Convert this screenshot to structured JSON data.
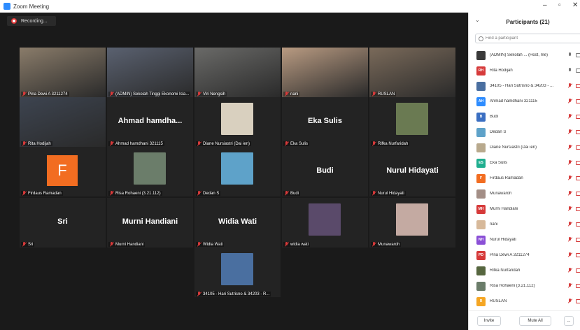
{
  "window": {
    "title": "Zoom Meeting",
    "controls": [
      "–",
      "▫",
      "✕"
    ]
  },
  "recording": {
    "label": "Recording..."
  },
  "tiles": [
    {
      "name": "Pina Dewi A 3211274",
      "big": "",
      "kind": "video",
      "color": "#8a7c6a"
    },
    {
      "name": "(ADMIN) Sekolah Tinggi Ekonomi Isla...",
      "big": "",
      "kind": "video",
      "color": "#5a6170"
    },
    {
      "name": "Viri Nengsih",
      "big": "",
      "kind": "video",
      "color": "#6a6a68"
    },
    {
      "name": "nani",
      "big": "",
      "kind": "video",
      "color": "#b99b82"
    },
    {
      "name": "RUSLAN",
      "big": "",
      "kind": "video",
      "color": "#7a6a5a"
    },
    {
      "name": "Rita Hodijah",
      "big": "",
      "kind": "video",
      "color": "#3d4450"
    },
    {
      "name": "Ahmad hamdhani 321115",
      "big": "Ahmad  hamdha...",
      "kind": "name"
    },
    {
      "name": "Diane Nursiastri (Dai ien)",
      "big": "",
      "kind": "avatar",
      "color": "#d9d0bf"
    },
    {
      "name": "Eka Sulis",
      "big": "Eka Sulis",
      "kind": "name"
    },
    {
      "name": "Rifka Nurfaridah",
      "big": "",
      "kind": "avatar",
      "color": "#6a7a52"
    },
    {
      "name": "Firdaus Ramadan",
      "big": "F",
      "kind": "letter"
    },
    {
      "name": "Risa Rohaeni (3.21.112)",
      "big": "",
      "kind": "avatar",
      "color": "#6b7d6a"
    },
    {
      "name": "Dedan S",
      "big": "",
      "kind": "avatar",
      "color": "#5ea2c9"
    },
    {
      "name": "Budi",
      "big": "Budi",
      "kind": "name"
    },
    {
      "name": "Nurul Hidayati",
      "big": "Nurul Hidayati",
      "kind": "name"
    },
    {
      "name": "Sri",
      "big": "Sri",
      "kind": "name"
    },
    {
      "name": "Murni Handiani",
      "big": "Murni Handiani",
      "kind": "name"
    },
    {
      "name": "Widia Wati",
      "big": "Widia Wati",
      "kind": "name"
    },
    {
      "name": "widia wati",
      "big": "",
      "kind": "avatar",
      "color": "#5a4a6a"
    },
    {
      "name": "Munawaroh",
      "big": "",
      "kind": "avatar",
      "color": "#c4aaa2"
    },
    {
      "name": "34105 - Hari Sutrisno & 34203 - R...",
      "big": "",
      "kind": "avatar",
      "color": "#4a6fa0"
    }
  ],
  "panel": {
    "title": "Participants (21)",
    "collapse_icon": "chevron-down-icon",
    "search_placeholder": "Find a participant",
    "participants": [
      {
        "name": "(ADMIN) Sekolah ... (Host, me)",
        "initials": "",
        "color": "#3a3a3a",
        "mic": "on",
        "cam": "on"
      },
      {
        "name": "Rita Hodijah",
        "initials": "RH",
        "color": "#d63a3a",
        "mic": "on",
        "cam": "on"
      },
      {
        "name": "34105 - Hari Sutrisno & 34203 - ...",
        "initials": "",
        "color": "#4a6fa0",
        "mic": "off",
        "cam": "off"
      },
      {
        "name": "Ahmad hamdhani 321115",
        "initials": "AH",
        "color": "#2d8cff",
        "mic": "off",
        "cam": "off"
      },
      {
        "name": "Budi",
        "initials": "B",
        "color": "#3b6fc2",
        "mic": "off",
        "cam": "off"
      },
      {
        "name": "Dedan S",
        "initials": "",
        "color": "#5ea2c9",
        "mic": "off",
        "cam": "off"
      },
      {
        "name": "Diane Nursiastri (Dai ien)",
        "initials": "",
        "color": "#b8a98d",
        "mic": "off",
        "cam": "off"
      },
      {
        "name": "Eka Sulis",
        "initials": "ES",
        "color": "#1fae8f",
        "mic": "off",
        "cam": "off"
      },
      {
        "name": "Firdaus Ramadan",
        "initials": "F",
        "color": "#f26d21",
        "mic": "off",
        "cam": "off"
      },
      {
        "name": "Munawaroh",
        "initials": "",
        "color": "#a38e86",
        "mic": "off",
        "cam": "off"
      },
      {
        "name": "Murni Handiani",
        "initials": "MH",
        "color": "#d63a3a",
        "mic": "off",
        "cam": "off"
      },
      {
        "name": "nani",
        "initials": "",
        "color": "#d7b99a",
        "mic": "off",
        "cam": "off"
      },
      {
        "name": "Nurul Hidayati",
        "initials": "NH",
        "color": "#8a4fd6",
        "mic": "off",
        "cam": "off"
      },
      {
        "name": "Pina Dewi A 3211274",
        "initials": "PD",
        "color": "#d63a3a",
        "mic": "off",
        "cam": "off"
      },
      {
        "name": "Rifka Nurfaridah",
        "initials": "",
        "color": "#56663f",
        "mic": "off",
        "cam": "off"
      },
      {
        "name": "Risa Rohaeni (3.21.112)",
        "initials": "",
        "color": "#6b7d6a",
        "mic": "off",
        "cam": "off"
      },
      {
        "name": "RUSLAN",
        "initials": "R",
        "color": "#f5a623",
        "mic": "off",
        "cam": "off"
      }
    ],
    "invite_label": "Invite",
    "mute_all_label": "Mute All",
    "more_label": "..."
  }
}
